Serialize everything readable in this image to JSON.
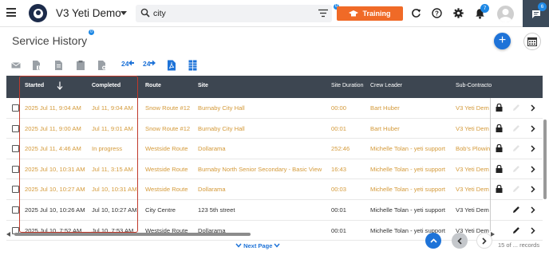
{
  "header": {
    "app_name": "V3 Yeti Demo",
    "search_value": "city",
    "filter_badge": "0",
    "training_label": "Training",
    "notifications_count": "7",
    "messages_count": "6"
  },
  "page": {
    "title": "Service History",
    "title_badge": "0",
    "add_label": "+"
  },
  "toolbar": {
    "btn_24_left": "24",
    "btn_24_right": "24"
  },
  "table": {
    "columns": [
      "Started",
      "Completed",
      "Route",
      "Site",
      "Site Duration",
      "Crew Leader",
      "Sub-Contracto"
    ],
    "rows": [
      {
        "started": "2025 Jul 11, 9:04 AM",
        "completed": "Jul 11, 9:04 AM",
        "route": "Snow Route #12",
        "site": "Burnaby City Hall",
        "duration": "00:00",
        "crew": "Bart Huber",
        "sub": "V3 Yeti Dem"
      },
      {
        "started": "2025 Jul 11, 9:00 AM",
        "completed": "Jul 11, 9:01 AM",
        "route": "Snow Route #12",
        "site": "Burnaby City Hall",
        "duration": "00:01",
        "crew": "Bart Huber",
        "sub": "V3 Yeti Dem"
      },
      {
        "started": "2025 Jul 11, 4:46 AM",
        "completed": "In progress",
        "route": "Westside Route",
        "site": "Dollarama",
        "duration": "252:46",
        "crew": "Michelle Tolan - yeti support",
        "sub": "Bob's Plowin"
      },
      {
        "started": "2025 Jul 10, 10:31 AM",
        "completed": "Jul 11, 3:15 AM",
        "route": "Westside Route",
        "site": "Burnaby North Senior Secondary - Basic View",
        "duration": "16:43",
        "crew": "Michelle Tolan - yeti support",
        "sub": "V3 Yeti Dem"
      },
      {
        "started": "2025 Jul 10, 10:27 AM",
        "completed": "Jul 10, 10:31 AM",
        "route": "Westside Route",
        "site": "Dollarama",
        "duration": "00:03",
        "crew": "Michelle Tolan - yeti support",
        "sub": "V3 Yeti Dem"
      },
      {
        "started": "2025 Jul 10, 10:26 AM",
        "completed": "Jul 10, 10:27 AM",
        "route": "City Centre",
        "site": "123 5th street",
        "duration": "00:01",
        "crew": "Michelle Tolan - yeti support",
        "sub": "V3 Yeti Dem"
      },
      {
        "started": "2025 Jul 10, 7:52 AM",
        "completed": "Jul 10, 7:53 AM",
        "route": "Westside Route",
        "site": "Dollarama",
        "duration": "00:01",
        "crew": "Michelle Tolan - yeti support",
        "sub": "V3 Yeti Dem"
      }
    ]
  },
  "footer": {
    "next_page_label": "Next Page",
    "records_label": "15 of ... records"
  },
  "colors": {
    "accent": "#1e73d8",
    "training": "#f06a27",
    "header_dark": "#3d4651",
    "in_progress_text": "#d49a3a",
    "highlight_border": "#c0392b"
  }
}
